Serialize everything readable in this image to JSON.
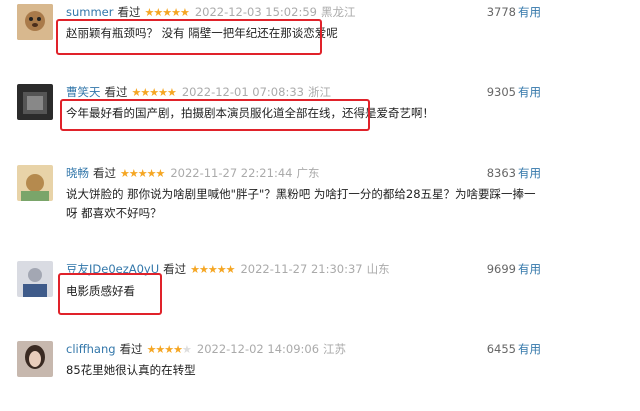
{
  "reviews": [
    {
      "user": "summer",
      "watched": "看过",
      "stars": 5,
      "time": "2022-12-03 15:02:59",
      "location": "黑龙江",
      "votes": "3778",
      "useful": "有用",
      "text": "赵丽颖有瓶颈吗？ 没有 隔壁一把年纪还在那谈恋爱呢"
    },
    {
      "user": "曹笑天",
      "watched": "看过",
      "stars": 5,
      "time": "2022-12-01 07:08:33",
      "location": "浙江",
      "votes": "9305",
      "useful": "有用",
      "text": "今年最好看的国产剧，拍摄剧本演员服化道全部在线，还得是爱奇艺啊！"
    },
    {
      "user": "晓畅",
      "watched": "看过",
      "stars": 5,
      "time": "2022-11-27 22:21:44",
      "location": "广东",
      "votes": "8363",
      "useful": "有用",
      "text": "说大饼脸的 那你说为啥剧里喊他\"胖子\"？黑粉吧 为啥打一分的都给28五星？为啥要踩一捧一呀 都喜欢不好吗？"
    },
    {
      "user": "豆友JDe0ezA0yU",
      "watched": "看过",
      "stars": 5,
      "time": "2022-11-27 21:30:37",
      "location": "山东",
      "votes": "9699",
      "useful": "有用",
      "text": "电影质感好看"
    },
    {
      "user": "cliffhang",
      "watched": "看过",
      "stars": 4,
      "time": "2022-12-02 14:09:06",
      "location": "江苏",
      "votes": "6455",
      "useful": "有用",
      "text": "85花里她很认真的在转型"
    }
  ],
  "colors": {
    "link": "#3377aa",
    "star": "#f5a623",
    "highlight": "#e0222a"
  }
}
